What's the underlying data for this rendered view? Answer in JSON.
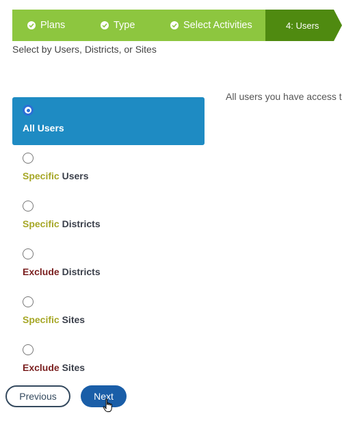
{
  "wizard": {
    "steps": [
      {
        "label": "Plans",
        "done": true
      },
      {
        "label": "Type",
        "done": true
      },
      {
        "label": "Select Activities",
        "done": true
      }
    ],
    "current_step": "4: Users"
  },
  "instructions": "Select by Users, Districts, or Sites",
  "selected_description": "All users you have access t",
  "options": [
    {
      "keyword": "",
      "rest": "All Users",
      "selected": true
    },
    {
      "keyword": "Specific",
      "rest": " Users",
      "selected": false
    },
    {
      "keyword": "Specific",
      "rest": " Districts",
      "selected": false
    },
    {
      "keyword": "Exclude",
      "rest": " Districts",
      "selected": false
    },
    {
      "keyword": "Specific",
      "rest": " Sites",
      "selected": false
    },
    {
      "keyword": "Exclude",
      "rest": " Sites",
      "selected": false
    }
  ],
  "buttons": {
    "previous": "Previous",
    "next": "Next"
  },
  "colors": {
    "step_done": "#8dc63f",
    "step_current": "#4f8a10",
    "selected_option": "#1e8bc3",
    "specific_keyword": "#a6a726",
    "exclude_keyword": "#7a1f1f",
    "next_button": "#1a5ea8"
  },
  "icons": [
    "check-circle-icon",
    "hand-pointer-cursor-icon"
  ]
}
